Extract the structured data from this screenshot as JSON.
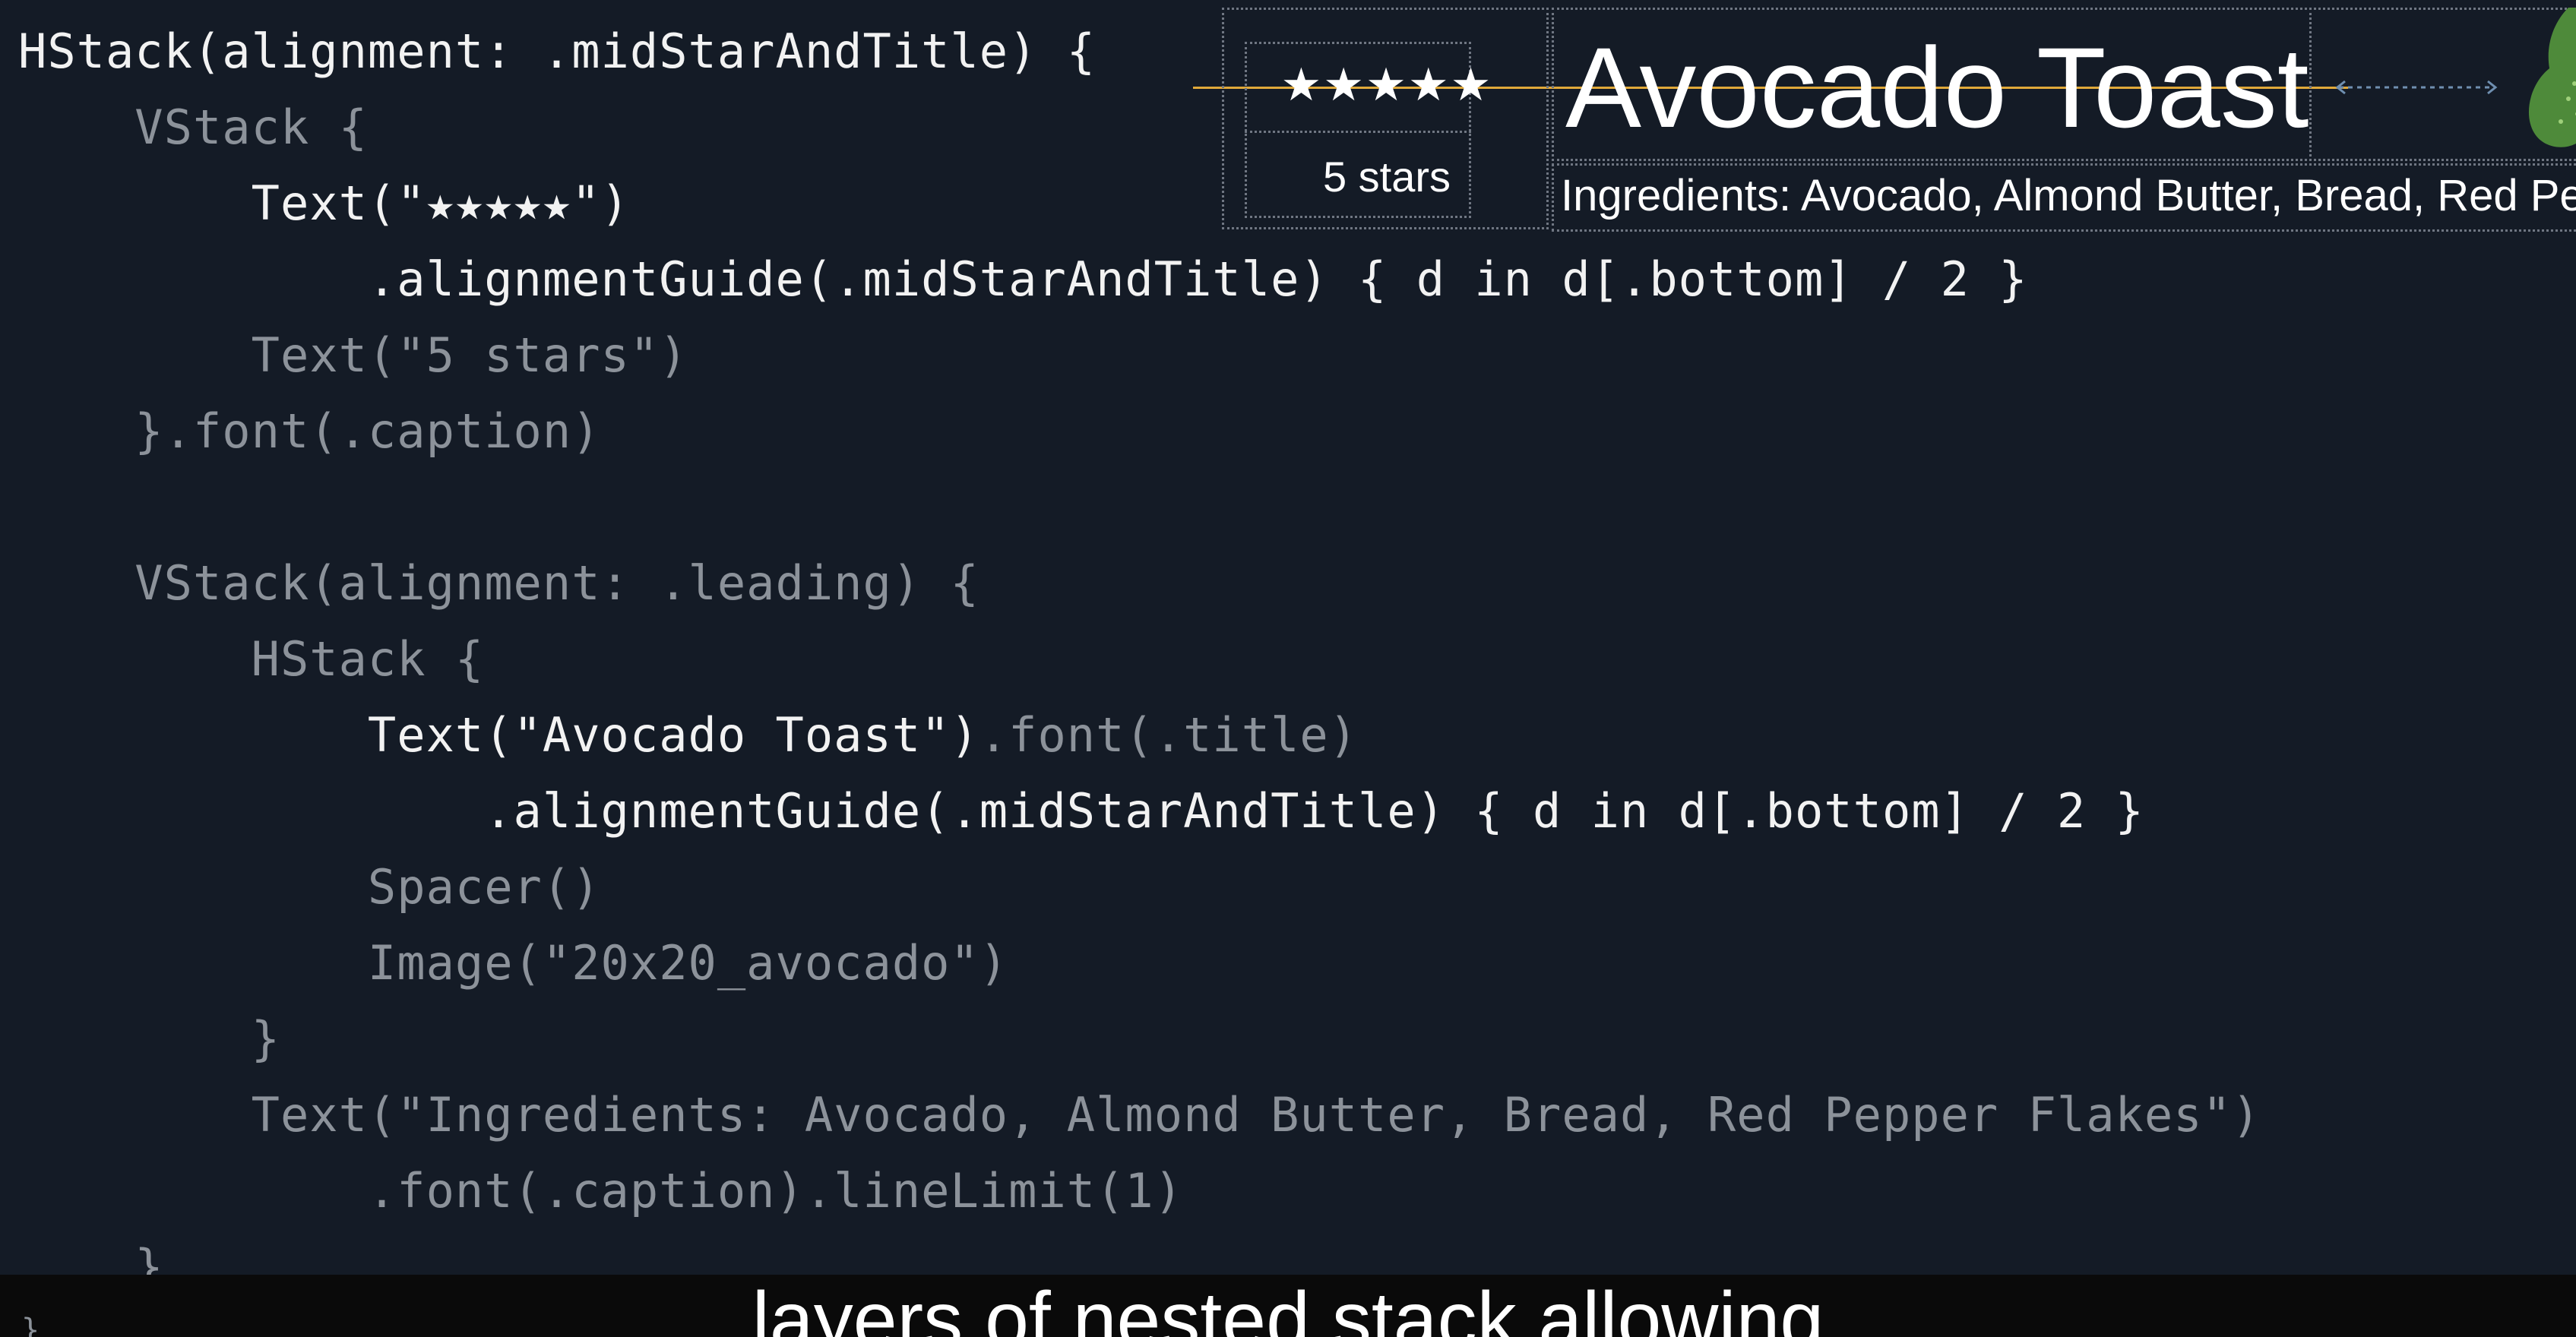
{
  "code": {
    "lines": [
      {
        "segments": [
          {
            "text": "HStack(alignment: .midStarAndTitle) {",
            "tone": "bright"
          }
        ]
      },
      {
        "segments": [
          {
            "text": "    VStack {",
            "tone": "dim"
          }
        ]
      },
      {
        "segments": [
          {
            "text": "        Text(\"★★★★★\")",
            "tone": "bright"
          }
        ]
      },
      {
        "segments": [
          {
            "text": "            .alignmentGuide(.midStarAndTitle) { d in d[.bottom] / 2 }",
            "tone": "bright"
          }
        ]
      },
      {
        "segments": [
          {
            "text": "        Text(\"5 stars\")",
            "tone": "dim"
          }
        ]
      },
      {
        "segments": [
          {
            "text": "    }.font(.caption)",
            "tone": "dim"
          }
        ]
      },
      {
        "segments": [
          {
            "text": "",
            "tone": "dim"
          }
        ]
      },
      {
        "segments": [
          {
            "text": "    VStack(alignment: .leading) {",
            "tone": "dim"
          }
        ]
      },
      {
        "segments": [
          {
            "text": "        HStack {",
            "tone": "dim"
          }
        ]
      },
      {
        "segments": [
          {
            "text": "            Text(\"Avocado Toast\")",
            "tone": "bright"
          },
          {
            "text": ".font(.title)",
            "tone": "dim"
          }
        ]
      },
      {
        "segments": [
          {
            "text": "                .alignmentGuide(.midStarAndTitle) { d in d[.bottom] / 2 }",
            "tone": "bright"
          }
        ]
      },
      {
        "segments": [
          {
            "text": "            Spacer()",
            "tone": "dim"
          }
        ]
      },
      {
        "segments": [
          {
            "text": "            Image(\"20x20_avocado\")",
            "tone": "dim"
          }
        ]
      },
      {
        "segments": [
          {
            "text": "        }",
            "tone": "dim"
          }
        ]
      },
      {
        "segments": [
          {
            "text": "        Text(\"Ingredients: Avocado, Almond Butter, Bread, Red Pepper Flakes\")",
            "tone": "dim"
          }
        ]
      },
      {
        "segments": [
          {
            "text": "            .font(.caption).lineLimit(1)",
            "tone": "dim"
          }
        ]
      },
      {
        "segments": [
          {
            "text": "    }",
            "tone": "dim"
          }
        ]
      }
    ],
    "closing_brace": "}"
  },
  "preview": {
    "stars": "★★★★★",
    "stars_caption": "5 stars",
    "title": "Avocado Toast",
    "ingredients": "Ingredients: Avocado, Almond Butter, Bread, Red Pepper Flakes",
    "guide_color": "#e0a93a",
    "spacer_arrow_color": "#6f8fb0",
    "avocado_color": "#4e8a3a"
  },
  "caption": {
    "text": "layers of nested stack allowing"
  },
  "colors": {
    "background": "#141b26",
    "code_bright": "#f2f2f2",
    "code_dim": "#8c929a",
    "caption_bar": "#0a0a0a"
  }
}
